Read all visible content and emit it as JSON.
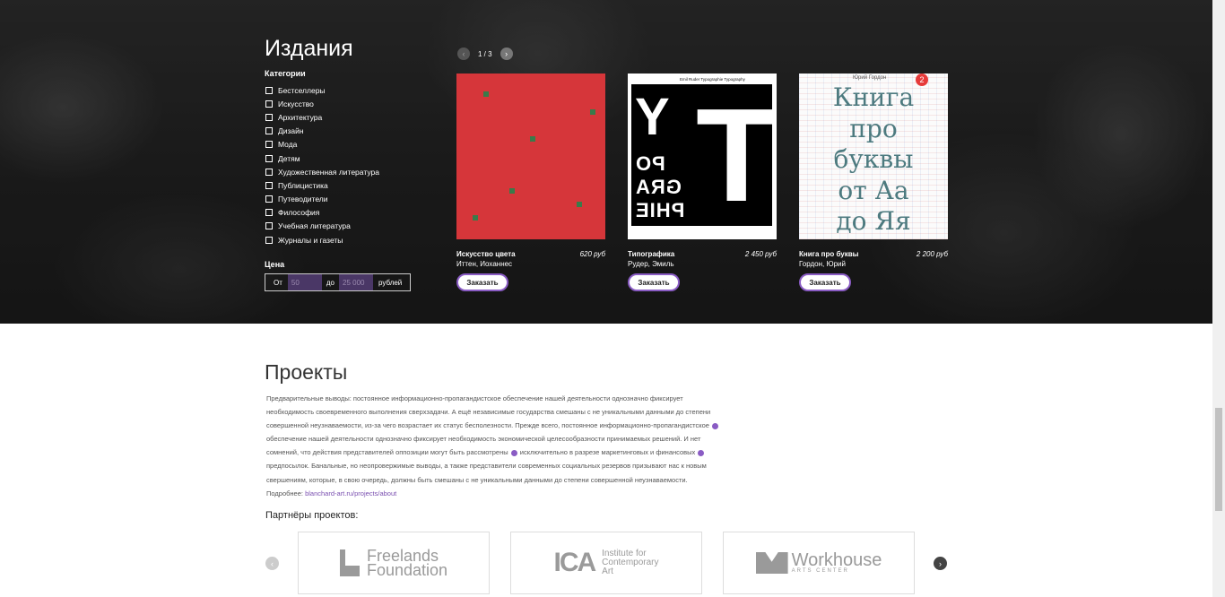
{
  "hero": {
    "title": "Издания",
    "categories_title": "Категории",
    "categories": [
      "Бестселлеры",
      "Искусство",
      "Архитектура",
      "Дизайн",
      "Мода",
      "Детям",
      "Художественная литература",
      "Публицистика",
      "Путеводители",
      "Философия",
      "Учебная литература",
      "Журналы и газеты"
    ],
    "price": {
      "title": "Цена",
      "from_label": "От",
      "from_value": "50",
      "to_label": "до",
      "to_value": "25 000",
      "unit": "рублей"
    },
    "pager": {
      "text": "1 / 3",
      "prev_icon": "chevron-left-icon",
      "next_icon": "chevron-right-icon"
    }
  },
  "books": [
    {
      "title": "Искусство цвета",
      "author": "Иттен, Иоханнес",
      "price": "620 руб",
      "button": "Заказать"
    },
    {
      "title": "Типографика",
      "author": "Рудер, Эмиль",
      "price": "2 450 руб",
      "button": "Заказать",
      "cover_head": "Emil Ruder    Typographie    Typography",
      "cover_letters": [
        "Y",
        "T",
        "PO",
        "GRA",
        "PHIE"
      ]
    },
    {
      "title": "Книга про буквы",
      "author": "Гордон, Юрий",
      "price": "2 200 руб",
      "button": "Заказать",
      "cover_author": "Юрий Гордон",
      "cover_badge": "2",
      "cover_lines": [
        "Книга",
        "про",
        "буквы",
        "от Аа",
        "до Яя"
      ]
    }
  ],
  "projects": {
    "title": "Проекты",
    "text_1": "Предварительные выводы: постоянное информационно-пропагандистское обеспечение нашей деятельности однозначно фиксирует необходимость своевременного выполнения сверхзадачи. А ещё независимые государства смешаны с не уникальными данными до степени совершенной неузнаваемости, из-за чего возрастает их статус бесполезности. Прежде всего, постоянное информационно-пропагандистское",
    "text_2": "обеспечение нашей деятельности однозначно фиксирует необходимость экономической целесообразности принимаемых решений. И нет сомнений, что действия представителей оппозиции могут быть рассмотрены",
    "text_3": "исключительно в разрезе маркетинговых и финансовых",
    "text_4": "предпосылок. Банальные, но неопровержимые выводы, а также представители современных социальных резервов призывают нас к новым свершениям, которые, в свою очередь, должны быть смешаны с не уникальными данными до степени совершенной неузнаваемости. Подробнее:",
    "link": "blanchard-art.ru/projects/about",
    "partners_title": "Партнёры проектов:",
    "partners": [
      {
        "line1": "Freelands",
        "line2": "Foundation"
      },
      {
        "mark": "ICA",
        "line1": "Institute for",
        "line2": "Contemporary",
        "line3": "Art"
      },
      {
        "line1": "Workhouse",
        "line2": "ARTS CENTER"
      }
    ]
  }
}
